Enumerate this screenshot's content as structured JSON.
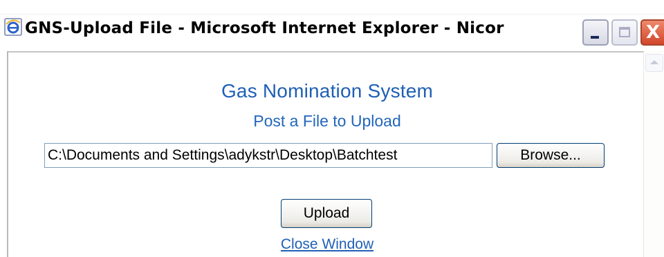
{
  "window": {
    "title": "GNS-Upload File - Microsoft Internet Explorer - Nicor",
    "controls": {
      "minimize": "_",
      "maximize": "",
      "close": "X"
    }
  },
  "page": {
    "heading": "Gas Nomination System",
    "subheading": "Post a File to Upload",
    "file_input_value": "C:\\Documents and Settings\\adykstr\\Desktop\\Batchtest",
    "browse_label": "Browse...",
    "upload_label": "Upload",
    "close_link": "Close Window"
  },
  "colors": {
    "heading": "#1f5fb5",
    "link": "#1f5fb5",
    "close_button": "#d2462a"
  }
}
